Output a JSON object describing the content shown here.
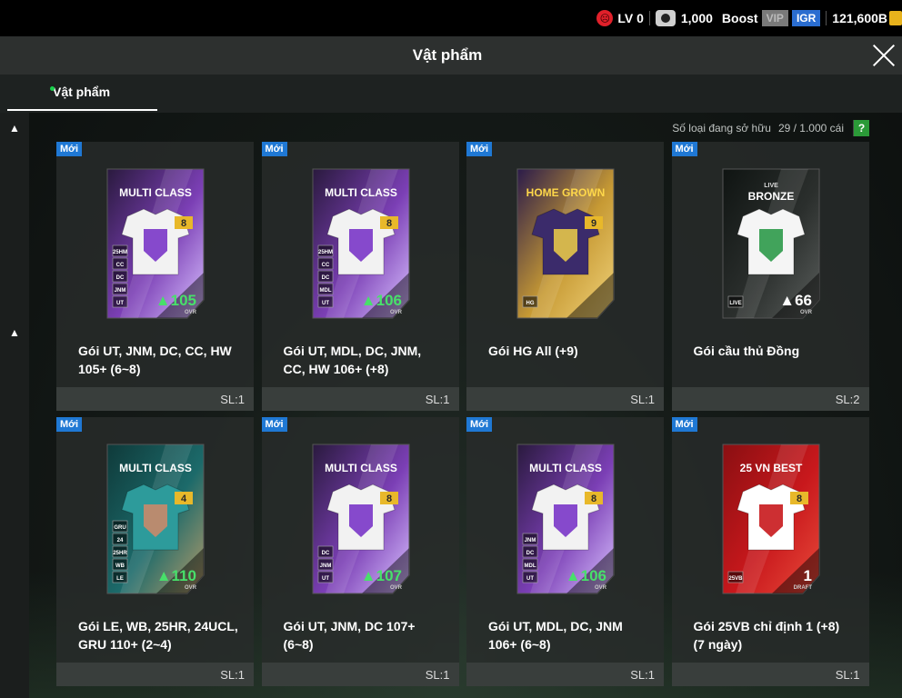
{
  "topbar": {
    "level": "LV 0",
    "watch_value": "1,000",
    "boost": "Boost",
    "vip": "VIP",
    "igr": "IGR",
    "currency": "121,600B"
  },
  "title": "Vật phẩm",
  "tabs": [
    {
      "label": "Vật phẩm",
      "active": true
    }
  ],
  "owned": {
    "label": "Số loại đang sở hữu",
    "value": "29 / 1.000 cái",
    "help": "?"
  },
  "items": [
    {
      "badge": "Mới",
      "name_l1": "Gói UT, JNM, DC, CC, HW",
      "name_l2": "105+ (6~8)",
      "qty": "SL:1",
      "card_title": "MULTI CLASS",
      "card_num": "8",
      "ovr": "105",
      "ovr_label": "OVR",
      "positions": [
        "25HM",
        "CC",
        "DC",
        "JNM",
        "UT"
      ],
      "style": "purple"
    },
    {
      "badge": "Mới",
      "name_l1": "Gói UT, MDL, DC, JNM,",
      "name_l2": "CC, HW 106+ (+8)",
      "qty": "SL:1",
      "card_title": "MULTI CLASS",
      "card_num": "8",
      "ovr": "106",
      "ovr_label": "OVR",
      "positions": [
        "25HM",
        "CC",
        "DC",
        "MDL",
        "UT"
      ],
      "style": "purple"
    },
    {
      "badge": "Mới",
      "name_l1": "Gói HG All (+9)",
      "name_l2": "",
      "qty": "SL:1",
      "card_title": "HOME GROWN",
      "card_num": "9",
      "ovr": "",
      "ovr_label": "",
      "positions": [
        "HG"
      ],
      "style": "homegrown"
    },
    {
      "badge": "Mới",
      "name_l1": "Gói cầu thủ Đồng",
      "name_l2": "",
      "qty": "SL:2",
      "card_title": "BRONZE",
      "card_sub": "LIVE",
      "card_num": "",
      "ovr": "66",
      "ovr_label": "OVR",
      "positions": [
        "LIVE"
      ],
      "style": "bronze"
    },
    {
      "badge": "Mới",
      "name_l1": "Gói LE, WB, 25HR, 24UCL,",
      "name_l2": "GRU 110+ (2~4)",
      "qty": "SL:1",
      "card_title": "MULTI CLASS",
      "card_num": "4",
      "ovr": "110",
      "ovr_label": "OVR",
      "positions": [
        "GRU",
        "24",
        "25HR",
        "WB",
        "LE"
      ],
      "style": "teal"
    },
    {
      "badge": "Mới",
      "name_l1": "Gói UT, JNM, DC 107+",
      "name_l2": "(6~8)",
      "qty": "SL:1",
      "card_title": "MULTI CLASS",
      "card_num": "8",
      "ovr": "107",
      "ovr_label": "OVR",
      "positions": [
        "DC",
        "JNM",
        "UT"
      ],
      "style": "purple"
    },
    {
      "badge": "Mới",
      "name_l1": "Gói UT, MDL, DC, JNM",
      "name_l2": "106+ (6~8)",
      "qty": "SL:1",
      "card_title": "MULTI CLASS",
      "card_num": "8",
      "ovr": "106",
      "ovr_label": "OVR",
      "positions": [
        "JNM",
        "DC",
        "MDL",
        "UT"
      ],
      "style": "purple"
    },
    {
      "badge": "Mới",
      "name_l1": "Gói 25VB chỉ định 1 (+8)",
      "name_l2": "(7 ngày)",
      "qty": "SL:1",
      "card_title": "25 VN BEST",
      "card_num": "8",
      "ovr": "1",
      "ovr_label": "DRAFT",
      "positions": [
        "25VB"
      ],
      "style": "red"
    }
  ]
}
